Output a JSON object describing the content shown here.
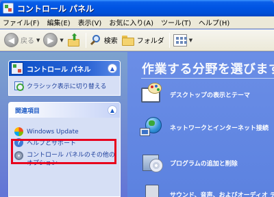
{
  "window": {
    "title": "コントロール パネル"
  },
  "menu": [
    "ファイル(F)",
    "編集(E)",
    "表示(V)",
    "お気に入り(A)",
    "ツール(T)",
    "ヘルプ(H)"
  ],
  "toolbar": {
    "back_label": "戻る",
    "search_label": "検索",
    "folders_label": "フォルダ"
  },
  "left_panel": {
    "control_panel_title": "コントロール パネル",
    "classic_view_link": "クラシック表示に切り替える",
    "related_title": "関連項目",
    "related_items": [
      "Windows Update",
      "ヘルプとサポート",
      "コントロール パネルのその他のオプション"
    ]
  },
  "main": {
    "heading": "作業する分野を選びます",
    "categories": [
      "デスクトップの表示とテーマ",
      "ネットワークとインターネット接続",
      "プログラムの追加と削除",
      "サウンド、音声、およびオーディオ デバイス"
    ]
  },
  "colors": {
    "title_bar": "#0054e3",
    "highlight_box": "#e8001c",
    "main_background": "#6b8ee6"
  }
}
